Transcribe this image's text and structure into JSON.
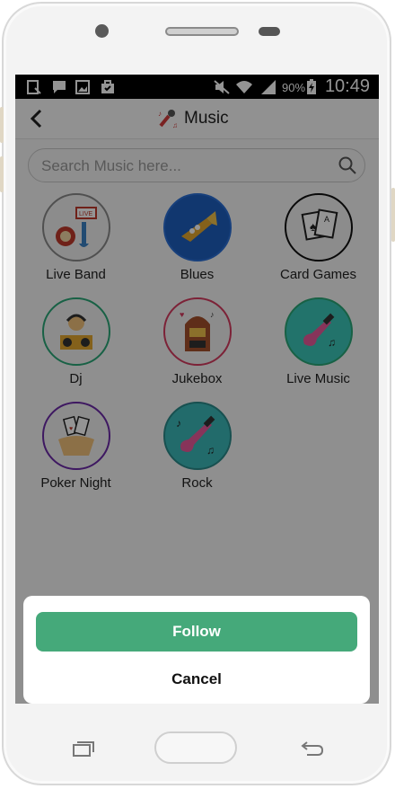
{
  "status_bar": {
    "time": "10:49",
    "battery": "90%",
    "icons": [
      "download-icon",
      "message-icon",
      "image-icon",
      "briefcase-icon",
      "mute-icon",
      "wifi-icon",
      "signal-icon",
      "battery-icon"
    ]
  },
  "app_bar": {
    "title": "Music",
    "back_icon": "chevron-left-icon",
    "title_icon": "microphone-icon"
  },
  "search": {
    "placeholder": "Search Music here..."
  },
  "categories": [
    {
      "label": "Live Band",
      "ring": "#8a8a8a",
      "icon": "live-band-icon"
    },
    {
      "label": "Blues",
      "ring": "#2a6fd6",
      "icon": "trumpet-icon"
    },
    {
      "label": "Card Games",
      "ring": "#111111",
      "icon": "cards-icon"
    },
    {
      "label": "Dj",
      "ring": "#2aa878",
      "icon": "dj-icon"
    },
    {
      "label": "Jukebox",
      "ring": "#d63b60",
      "icon": "jukebox-icon"
    },
    {
      "label": "Live Music",
      "ring": "#2aa878",
      "icon": "guitar-icon"
    },
    {
      "label": "Poker Night",
      "ring": "#6b2aa8",
      "icon": "poker-hands-icon"
    },
    {
      "label": "Rock",
      "ring": "#2a8a8a",
      "icon": "rock-guitar-icon"
    }
  ],
  "sheet": {
    "follow_label": "Follow",
    "cancel_label": "Cancel"
  },
  "colors": {
    "accent": "#45a97a",
    "overlay": "rgba(0,0,0,0.42)"
  }
}
